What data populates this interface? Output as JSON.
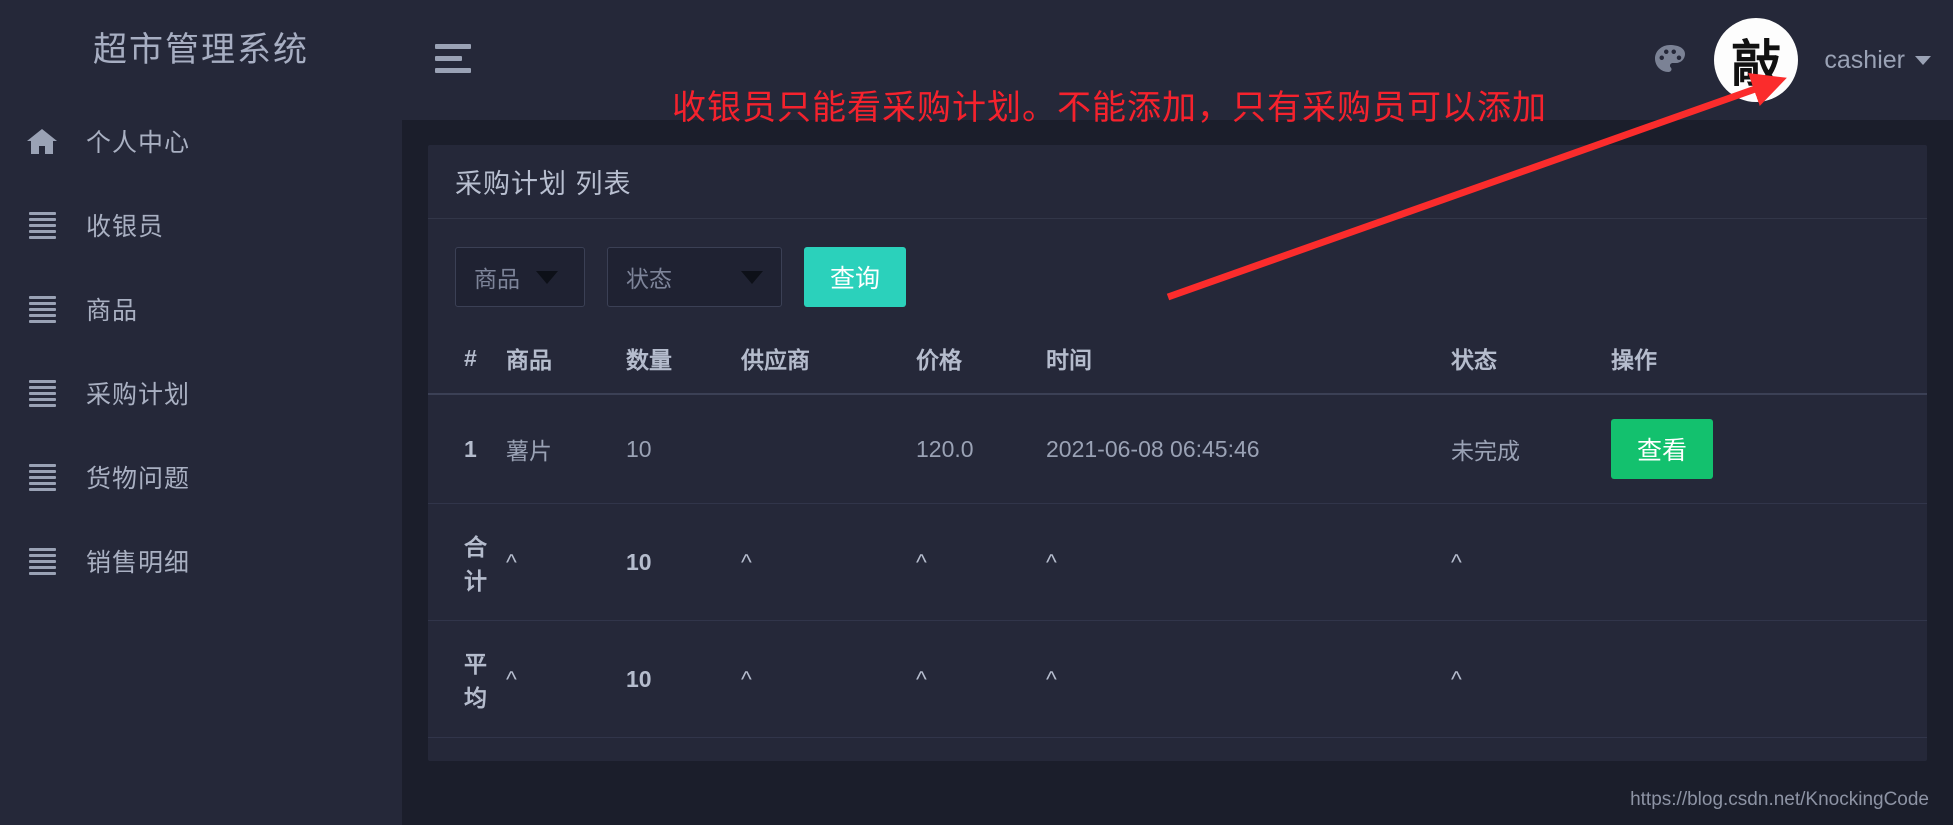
{
  "sidebar": {
    "brand": "超市管理系统",
    "items": [
      {
        "label": "个人中心",
        "icon": "home-icon"
      },
      {
        "label": "收银员",
        "icon": "list-icon"
      },
      {
        "label": "商品",
        "icon": "list-icon"
      },
      {
        "label": "采购计划",
        "icon": "list-icon"
      },
      {
        "label": "货物问题",
        "icon": "list-icon"
      },
      {
        "label": "销售明细",
        "icon": "list-icon"
      }
    ]
  },
  "header": {
    "menu_toggle": "hamburger-icon",
    "theme_icon": "palette-icon",
    "avatar_text": "敲",
    "username": "cashier"
  },
  "annotation": {
    "text": "收银员只能看采购计划。不能添加，只有采购员可以添加",
    "color": "#f5222d"
  },
  "card": {
    "title": "采购计划 列表",
    "filters": {
      "product_select": "商品",
      "status_select": "状态",
      "query_button": "查询"
    },
    "table": {
      "headers": [
        "#",
        "商品",
        "数量",
        "供应商",
        "价格",
        "时间",
        "状态",
        "操作"
      ],
      "rows": [
        {
          "index": "1",
          "product": "薯片",
          "quantity": "10",
          "supplier": "",
          "price": "120.0",
          "time": "2021-06-08 06:45:46",
          "status": "未完成",
          "action": "查看"
        }
      ],
      "summary": [
        {
          "label": "合计",
          "product": "^",
          "quantity": "10",
          "supplier": "^",
          "price": "^",
          "time": "^",
          "status": "^",
          "action": ""
        },
        {
          "label": "平均",
          "product": "^",
          "quantity": "10",
          "supplier": "^",
          "price": "^",
          "time": "^",
          "status": "^",
          "action": ""
        }
      ]
    }
  },
  "watermark": "https://blog.csdn.net/KnockingCode",
  "colors": {
    "sidebar_bg": "#252839",
    "page_bg": "#1b1e2b",
    "accent_teal": "#2bd1bb",
    "accent_green": "#13c16e",
    "annotation_red": "#f5222d"
  }
}
